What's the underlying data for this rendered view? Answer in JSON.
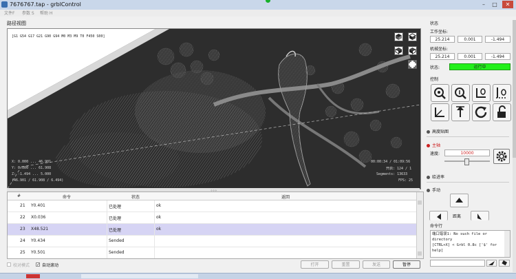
{
  "window": {
    "title": "7676767.tap - grblControl",
    "min": "–",
    "max": "□",
    "close": "✕"
  },
  "menu": [
    "文件F",
    "参数 S",
    "帮助 H"
  ],
  "viewer": {
    "label": "路径视图",
    "gcode_line": "[G1 G54 G17 G21 G90 G94 M0 M3 M9 T0 F450 S00]",
    "coords_left": [
      "X: 0.000 ... 46.901",
      "Y: 0.000 ... 61.908",
      "Z: -1.494 ... 5.000",
      "(46.901 / 61.908 / 6.494)"
    ],
    "coords_right": [
      "00:00:34 / 01:09:56",
      "开启: 124 / 1",
      "Segments: 13633",
      "FPS: 25"
    ],
    "view_icons": [
      "isometric-view-icon",
      "top-view-icon",
      "front-view-icon",
      "left-view-icon",
      "fit-view-icon"
    ]
  },
  "table": {
    "headers": {
      "num": "#",
      "cmd": "命令",
      "state": "状态",
      "reply": "返回"
    },
    "rows": [
      {
        "num": "21",
        "cmd": "Y0.401",
        "state": "已处理",
        "reply": "ok",
        "selected": false
      },
      {
        "num": "22",
        "cmd": "X0.036",
        "state": "已处理",
        "reply": "ok",
        "selected": false
      },
      {
        "num": "23",
        "cmd": "X48.521",
        "state": "已处理",
        "reply": "ok",
        "selected": true
      },
      {
        "num": "24",
        "cmd": "Y0.434",
        "state": "Sended",
        "reply": "",
        "selected": false
      },
      {
        "num": "25",
        "cmd": "Y0.501",
        "state": "Sended",
        "reply": "",
        "selected": false
      }
    ]
  },
  "bottom": {
    "check_mode": "校对模式",
    "auto_scroll": "自动滚动",
    "auto_scroll_checked": true,
    "open": "打开",
    "reset": "重置",
    "send": "发送",
    "pause": "暂停"
  },
  "status": {
    "section": "状态",
    "work_label": "工作坐标:",
    "work": [
      "25.214",
      "0.001",
      "-1.494"
    ],
    "machine_label": "机械坐标:",
    "machine": [
      "25.214",
      "0.001",
      "-1.494"
    ],
    "state_label": "状态:",
    "state_value": "运行中",
    "state_color": "#22f01a"
  },
  "control": {
    "section": "控制",
    "buttons": [
      "home-search-icon",
      "zoom-probe-icon",
      "zero-xy-icon",
      "zero-z-icon",
      "restore-origin-icon",
      "up-arrow-icon",
      "reset-icon",
      "unlock-icon"
    ]
  },
  "height_map": "高度贴图",
  "spindle": {
    "section": "主轴",
    "speed_label": "速度:",
    "speed_value": "10000",
    "slider_fraction": 0.48
  },
  "feed": "给进率",
  "manual": {
    "section": "手动",
    "distance": "距离"
  },
  "console": {
    "section": "命令行",
    "lines": [
      "端口错误1: No such file or",
      "directory",
      "[CTRL+X] < Grbl 0.8c ['$' for",
      "help]"
    ]
  }
}
